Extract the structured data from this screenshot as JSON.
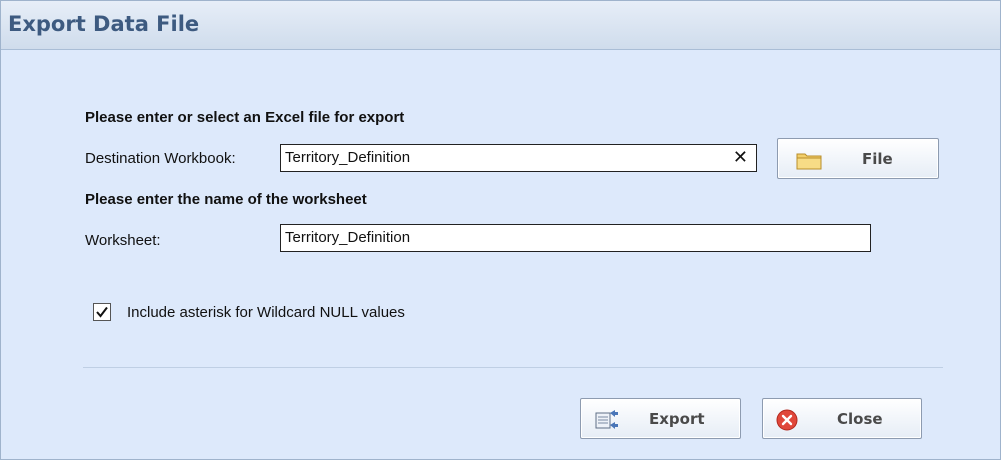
{
  "dialog": {
    "title": "Export Data File",
    "excel_section_heading": "Please enter or select an Excel file for export",
    "destination_label": "Destination Workbook:",
    "destination_value": "Territory_Definition",
    "clear_glyph": "✕",
    "file_button_label": "File",
    "worksheet_section_heading": "Please enter the name of the worksheet",
    "worksheet_label": "Worksheet:",
    "worksheet_value": "Territory_Definition",
    "wildcard_checkbox_label": "Include asterisk for Wildcard NULL values",
    "wildcard_checked": true,
    "export_button_label": "Export",
    "close_button_label": "Close"
  },
  "icons": {
    "file": "folder-icon",
    "export": "export-icon",
    "close": "close-circle-icon",
    "clear": "clear-x-icon",
    "check": "checkmark-icon"
  },
  "colors": {
    "title_text": "#3d5a80",
    "dialog_background": "#dde9fb",
    "close_icon": "#e0473a"
  }
}
